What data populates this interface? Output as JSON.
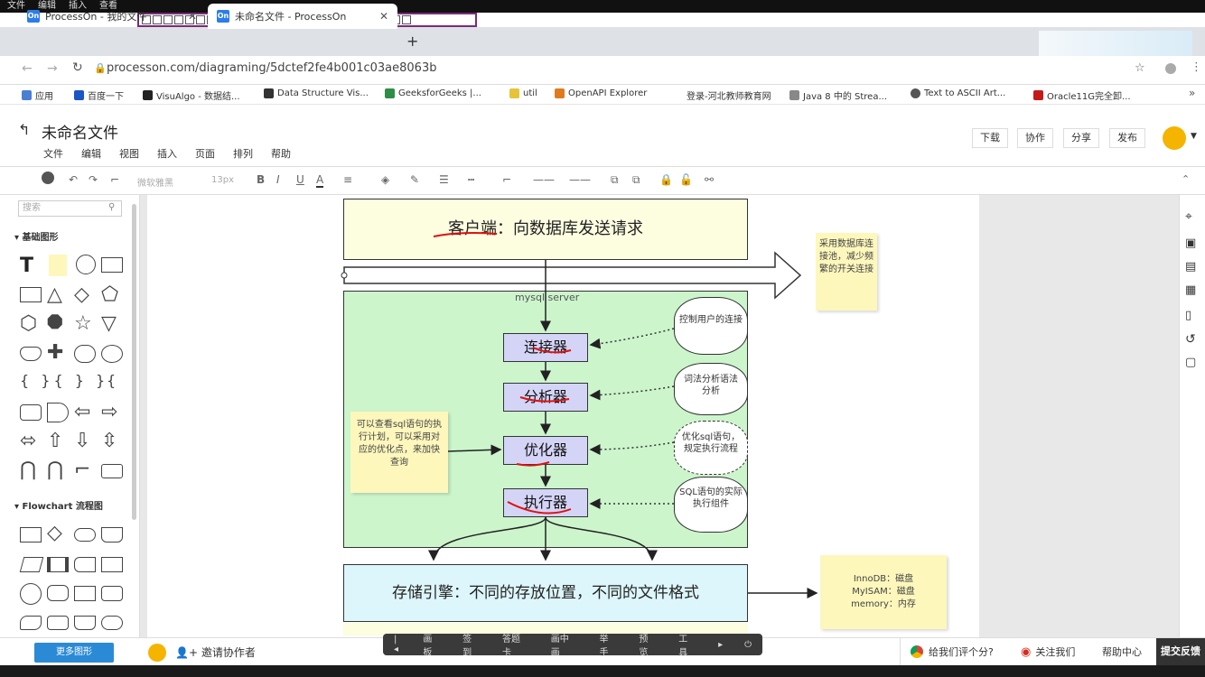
{
  "system_menu": [
    "文件",
    "编辑",
    "插入",
    "查看"
  ],
  "tabs": [
    {
      "icon": "On",
      "label": "ProcessOn - 我的文件"
    },
    {
      "icon": "On",
      "label": "未命名文件 - ProcessOn"
    }
  ],
  "address": {
    "url": "processon.com/diagraming/5dctef2fe4b001c03ae8063b"
  },
  "bookmarks": [
    "应用",
    "百度一下",
    "VisuAlgo - 数据结...",
    "Data Structure Vis...",
    "GeeksforGeeks |...",
    "util",
    "OpenAPI Explorer",
    "登录-河北教师教育网",
    "Java 8 中的 Strea...",
    "Text to ASCII Art...",
    "Oracle11G完全卸..."
  ],
  "bookmark_colors": [
    "#4a7fd4",
    "#1a56c4",
    "#222",
    "#333",
    "#2f8d46",
    "#e8c33a",
    "#e07a1f",
    "#888",
    "#888",
    "#555",
    "#c41a1a"
  ],
  "app": {
    "title": "未命名文件",
    "menus": [
      "文件",
      "编辑",
      "视图",
      "插入",
      "页面",
      "排列",
      "帮助"
    ],
    "buttons": [
      "下载",
      "协作",
      "分享",
      "发布"
    ]
  },
  "toolbar": {
    "font": "微软雅黑",
    "size": "13px"
  },
  "left_panel": {
    "search_placeholder": "搜索",
    "section_basic": "基础图形",
    "section_flowchart": "Flowchart 流程图",
    "more_shapes": "更多图形"
  },
  "diagram": {
    "client": "客户端：向数据库发送请求",
    "server_label": "mysql server",
    "steps": [
      "连接器",
      "分析器",
      "优化器",
      "执行器"
    ],
    "clouds": [
      "控制用户的连接",
      "词法分析语法分析",
      "优化sql语句，规定执行流程",
      "SQL语句的实际执行组件"
    ],
    "note_pool": "采用数据库连接池，减少频繁的开关连接",
    "note_plan": "可以查看sql语句的执行计划，可以采用对应的优化点，来加快查询",
    "storage": "存储引擎：不同的存放位置，不同的文件格式",
    "note_engines": [
      "InnoDB：磁盘",
      "MyISAM：磁盘",
      "memory：内存"
    ]
  },
  "bottom": {
    "invite": "邀请协作者",
    "meeting_items": [
      "画板",
      "签到",
      "答题卡",
      "画中画",
      "举手",
      "预览",
      "工具"
    ],
    "rate": "给我们评个分?",
    "follow": "关注我们",
    "help": "帮助中心",
    "feedback": "提交反馈"
  },
  "colors": {
    "accent": "#2b8ad6",
    "note": "#fdf7bc",
    "server_bg": "#ccf5cc",
    "client_bg": "#fdfde0",
    "storage_bg": "#ddf6fb",
    "step_bg": "#d4d4f7",
    "underline": "#d11"
  }
}
